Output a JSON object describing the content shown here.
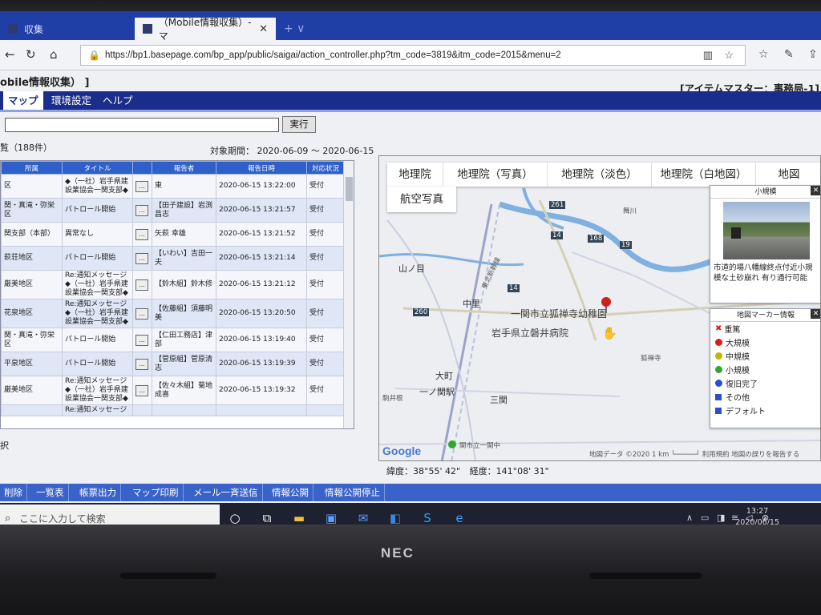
{
  "browser": {
    "inactive_tab": "収集",
    "active_tab": "（Mobile情報収集）-マ",
    "close": "✕",
    "new_tab": "+   ∨",
    "url": "https://bp1.basepage.com/bp_app/public/saigai/action_controller.php?tm_code=3819&itm_code=2015&menu=2"
  },
  "app": {
    "title": "obile情報収集） ]",
    "right_title": "[アイテムマスター：事務局-1]",
    "menu": [
      "マップ",
      "環境設定",
      "ヘルプ"
    ],
    "search_value": "",
    "exec_label": "実行",
    "list_count": "覧（188件）",
    "period": "対象期間： 2020-06-09 ～ 2020-06-15",
    "below_table": "択"
  },
  "table": {
    "headers": [
      "所属",
      "タイトル",
      "",
      "報告者",
      "報告日時",
      "対応状況"
    ],
    "rows": [
      {
        "area": "区",
        "title": "◆（一社）岩手県建設業協会一関支部◆",
        "btn": "...",
        "reporter": "東",
        "time": "2020-06-15 13:22:00",
        "status": "受付"
      },
      {
        "area": "関・真滝・弥栄区",
        "title": "パトロール開始",
        "btn": "...",
        "reporter": "【田子建設】岩渕昌志",
        "time": "2020-06-15 13:21:57",
        "status": "受付"
      },
      {
        "area": "関支部（本部）",
        "title": "異常なし",
        "btn": "...",
        "reporter": "矢萩 幸雄",
        "time": "2020-06-15 13:21:52",
        "status": "受付"
      },
      {
        "area": "萩荘地区",
        "title": "パトロール開始",
        "btn": "...",
        "reporter": "【いわい】吉田一夫",
        "time": "2020-06-15 13:21:14",
        "status": "受付"
      },
      {
        "area": "厳美地区",
        "title": "Re:通知メッセージ ◆（一社）岩手県建設業協会一関支部◆",
        "btn": "...",
        "reporter": "【鈴木組】鈴木修",
        "time": "2020-06-15 13:21:12",
        "status": "受付"
      },
      {
        "area": "花泉地区",
        "title": "Re:通知メッセージ ◆（一社）岩手県建設業協会一関支部◆",
        "btn": "...",
        "reporter": "【佐藤組】須藤明美",
        "time": "2020-06-15 13:20:50",
        "status": "受付"
      },
      {
        "area": "関・真滝・弥栄区",
        "title": "パトロール開始",
        "btn": "...",
        "reporter": "【仁田工務店】津部",
        "time": "2020-06-15 13:19:40",
        "status": "受付"
      },
      {
        "area": "平泉地区",
        "title": "パトロール開始",
        "btn": "...",
        "reporter": "【菅原組】菅原清志",
        "time": "2020-06-15 13:19:39",
        "status": "受付"
      },
      {
        "area": "厳美地区",
        "title": "Re:通知メッセージ ◆（一社）岩手県建設業協会一関支部◆",
        "btn": "...",
        "reporter": "【佐々木組】菊地成喜",
        "time": "2020-06-15 13:19:32",
        "status": "受付"
      },
      {
        "area": "",
        "title": "Re:通知メッセージ",
        "btn": "",
        "reporter": "",
        "time": "",
        "status": ""
      }
    ]
  },
  "map": {
    "types_row1": [
      "地理院",
      "地理院（写真）",
      "地理院（淡色）",
      "地理院（白地図）",
      "地図"
    ],
    "types_row2": "航空写真",
    "labels": {
      "yamanome": "山ノ目",
      "nakazato": "中里",
      "kindergarten": "一関市立狐禅寺幼稚園",
      "hospital": "岩手県立磐井病院",
      "omachi": "大町",
      "ichinoseki": "一ノ関駅",
      "sankan": "三関",
      "komaine": "駒井根",
      "kozenji": "狐禅寺",
      "school": "関市立一関中",
      "mairu": "舞川",
      "shinkansen": "東北新幹線",
      "r261": "261",
      "r14a": "14",
      "r14b": "14",
      "r168": "168",
      "r260": "260",
      "r19": "19",
      "google": "Google",
      "footer": "地図データ ©2020   1 km └─────┘   利用規約   地図の誤りを報告する"
    },
    "photo_panel": {
      "title": "小規模",
      "caption": "市道的場八幡線終点付近小規模な土砂崩れ 有り通行可能",
      "close": "✕"
    },
    "legend": {
      "title": "地図マーカー情報",
      "close": "✕",
      "items": [
        {
          "label": "重篤",
          "color": "#d42020"
        },
        {
          "label": "大規模",
          "color": "#d42020"
        },
        {
          "label": "中規模",
          "color": "#c9b300"
        },
        {
          "label": "小規模",
          "color": "#2ea82e"
        },
        {
          "label": "復旧完了",
          "color": "#2a4fc9"
        },
        {
          "label": "その他",
          "color": "#2a4fc9"
        },
        {
          "label": "デフォルト",
          "color": "#2a4fc9"
        }
      ]
    }
  },
  "coords": {
    "lat": "緯度：38°55'  42\"",
    "lng": "経度：141°08'  31\""
  },
  "actions": [
    "削除",
    "一覧表",
    "帳票出力",
    "マップ印刷",
    "メール一斉送信",
    "情報公開",
    "情報公開停止"
  ],
  "taskbar": {
    "search_placeholder": "ここに入力して検索",
    "time": "13:27",
    "date": "2020/06/15"
  },
  "device": {
    "brand": "NEC"
  },
  "colors": {
    "menubar": "#1b2d8c",
    "actionbar": "#3a63c9",
    "table_header": "#2f5fc9",
    "browser_tabs": "#1f3ea6"
  }
}
